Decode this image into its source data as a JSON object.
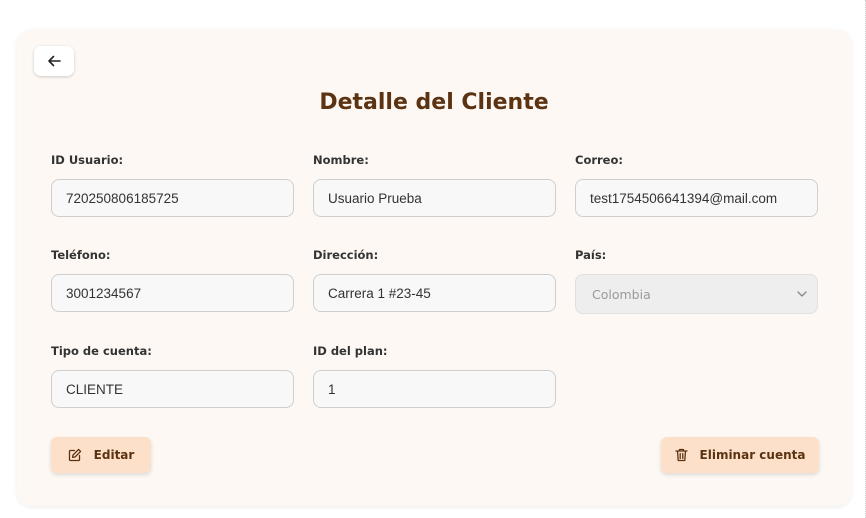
{
  "page": {
    "title": "Detalle del Cliente"
  },
  "fields": {
    "id_usuario": {
      "label": "ID Usuario:",
      "value": "720250806185725"
    },
    "nombre": {
      "label": "Nombre:",
      "value": "Usuario Prueba"
    },
    "correo": {
      "label": "Correo:",
      "value": "test1754506641394@mail.com"
    },
    "telefono": {
      "label": "Teléfono:",
      "value": "3001234567"
    },
    "direccion": {
      "label": "Dirección:",
      "value": "Carrera 1 #23-45"
    },
    "pais": {
      "label": "País:",
      "value": "Colombia",
      "disabled": true
    },
    "tipo_cuenta": {
      "label": "Tipo de cuenta:",
      "value": "CLIENTE"
    },
    "id_plan": {
      "label": "ID del plan:",
      "value": "1"
    }
  },
  "actions": {
    "edit_label": "Editar",
    "delete_label": "Eliminar cuenta"
  },
  "icons": {
    "back": "arrow-left-icon",
    "edit": "edit-icon",
    "delete": "trash-icon",
    "select": "chevron-down-icon"
  },
  "colors": {
    "card_background": "#fdf8f3",
    "title": "#5b3312",
    "button_background": "#fde0c9",
    "button_text": "#5b3312",
    "input_background": "#f8f8f8",
    "disabled_background": "#eeeeee"
  }
}
